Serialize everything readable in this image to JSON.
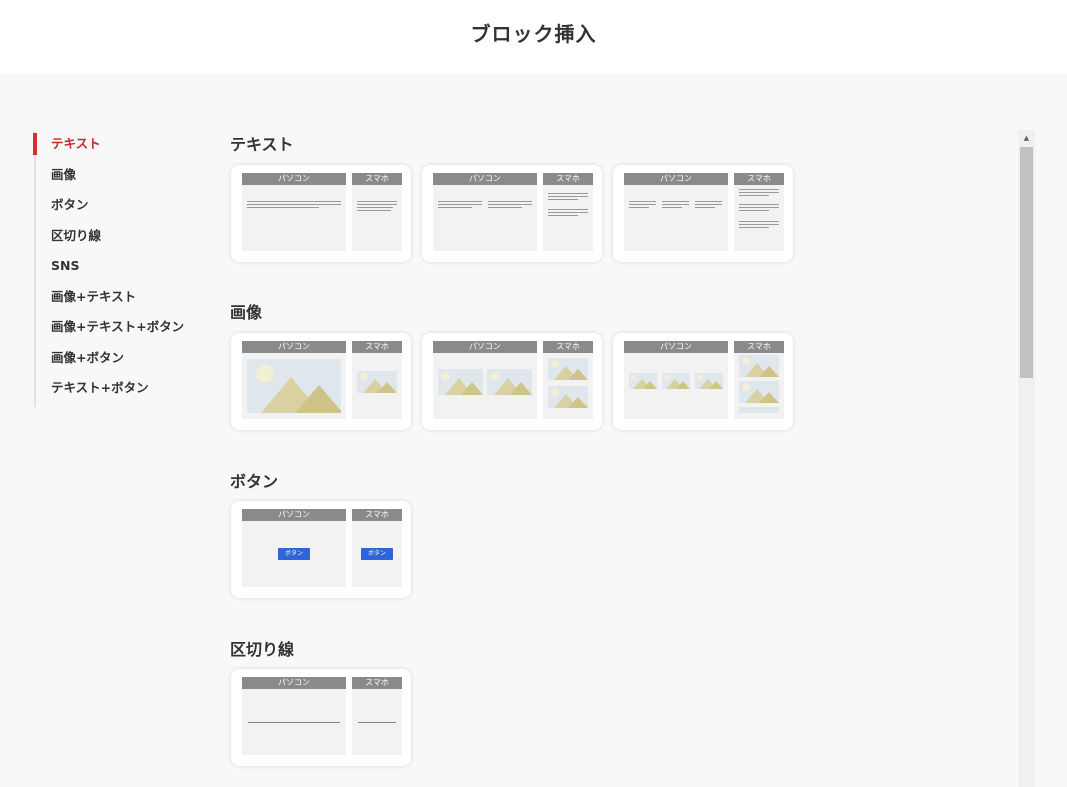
{
  "header": {
    "title": "ブロック挿入"
  },
  "sidebar": {
    "items": [
      {
        "label": "テキスト",
        "active": true
      },
      {
        "label": "画像"
      },
      {
        "label": "ボタン"
      },
      {
        "label": "区切り線"
      },
      {
        "label": "SNS"
      },
      {
        "label": "画像+テキスト"
      },
      {
        "label": "画像+テキスト+ボタン"
      },
      {
        "label": "画像+ボタン"
      },
      {
        "label": "テキスト+ボタン"
      }
    ]
  },
  "preview_labels": {
    "pc": "パソコン",
    "sp": "スマホ"
  },
  "button_preview_label": "ボタン",
  "sections": [
    {
      "title": "テキスト"
    },
    {
      "title": "画像"
    },
    {
      "title": "ボタン"
    },
    {
      "title": "区切り線"
    }
  ],
  "colors": {
    "accent": "#d32f2f",
    "button": "#2f63d6",
    "label_bar": "#8a8a8a"
  },
  "icons": {
    "scroll_up": "triangle-up"
  }
}
